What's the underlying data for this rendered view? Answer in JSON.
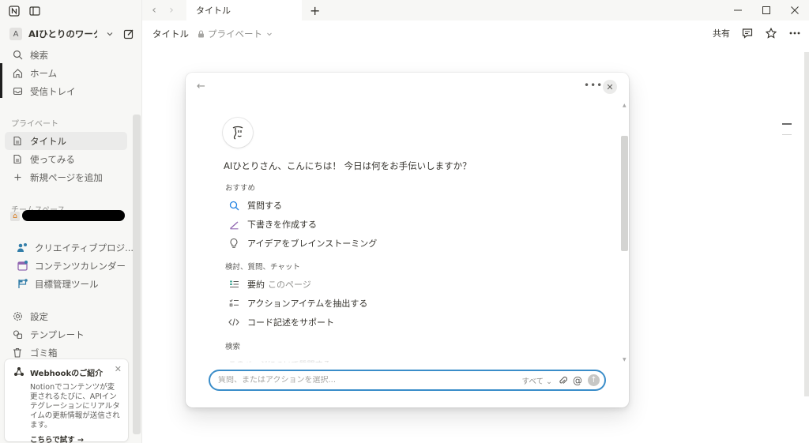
{
  "sidebar": {
    "workspace_avatar": "A",
    "workspace_name": "AIひとりのワーク...",
    "top_items": [
      {
        "label": "検索",
        "icon": "search-icon"
      },
      {
        "label": "ホーム",
        "icon": "home-icon"
      },
      {
        "label": "受信トレイ",
        "icon": "inbox-icon"
      }
    ],
    "private_section": "プライベート",
    "private_items": [
      {
        "label": "タイトル",
        "icon": "page-icon"
      },
      {
        "label": "使ってみる",
        "icon": "page-icon"
      },
      {
        "label": "新規ページを追加",
        "icon": "plus-icon"
      }
    ],
    "team_section": "チームスペース",
    "team_items": [
      {
        "label": "クリエイティブプロジ...",
        "icon": "people-icon"
      },
      {
        "label": "コンテンツカレンダー",
        "icon": "calendar-icon"
      },
      {
        "label": "目標管理ツール",
        "icon": "target-icon"
      }
    ],
    "bottom_items": [
      {
        "label": "設定",
        "icon": "gear-icon"
      },
      {
        "label": "テンプレート",
        "icon": "template-icon"
      },
      {
        "label": "ゴミ箱",
        "icon": "trash-icon"
      }
    ],
    "webhook": {
      "title": "Webhookのご紹介",
      "body": "Notionでコンテンツが変更されるたびに、APIインテグレーションにリアルタイムの更新情報が送信されます。",
      "link": "こちらで試す →"
    }
  },
  "tabbar": {
    "tab_label": "タイトル",
    "plus": "+"
  },
  "header": {
    "title": "タイトル",
    "private_label": "プライベート",
    "share": "共有"
  },
  "modal": {
    "greeting": "AIひとりさん、こんにちは！ 今日は何をお手伝いしますか？",
    "sections": [
      {
        "title": "おすすめ",
        "items": [
          {
            "label": "質問する",
            "icon": "search-icon"
          },
          {
            "label": "下書きを作成する",
            "icon": "pen-icon"
          },
          {
            "label": "アイデアをブレインストーミング",
            "icon": "lightbulb-icon"
          }
        ]
      },
      {
        "title": "検討、質問、チャット",
        "items": [
          {
            "label": "要約",
            "suffix": "このページ",
            "icon": "summary-icon"
          },
          {
            "label": "アクションアイテムを抽出する",
            "icon": "checklist-icon"
          },
          {
            "label": "コード記述をサポート",
            "icon": "code-icon"
          }
        ]
      },
      {
        "title": "検索",
        "items": []
      }
    ],
    "faded_item": "このページについて質問する",
    "input_placeholder": "質問、またはアクションを選択...",
    "scope_label": "すべて"
  }
}
